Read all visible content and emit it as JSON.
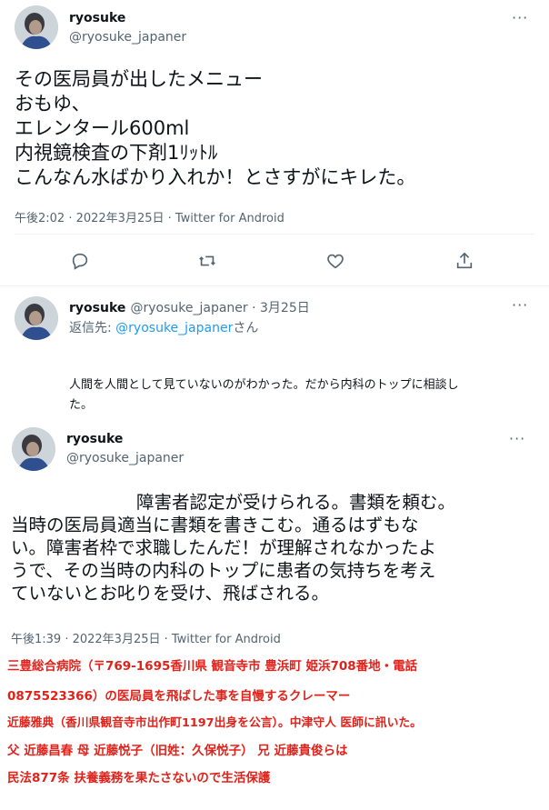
{
  "tweet1": {
    "name": "ryosuke",
    "handle": "@ryosuke_japaner",
    "more": "···",
    "body": "その医局員が出したメニュー\nおもゆ、\nエレンタール600ml\n内視鏡検査の下剤1ﾘｯﾄﾙ\nこんなん水ばかり入れか！とさすがにキレた。",
    "meta": "午後2:02 · 2022年3月25日 · Twitter for Android",
    "actions": [
      "reply-icon",
      "retweet-icon",
      "like-icon",
      "share-icon"
    ]
  },
  "tweet2": {
    "name": "ryosuke",
    "handle_date": "@ryosuke_japaner · 3月25日",
    "more": "···",
    "reply_prefix": "返信先: ",
    "reply_handle": "@ryosuke_japaner",
    "reply_suffix": "さん",
    "body_line1": "人間を人間として見ていないのがわかった。だから内科のトップに相談し",
    "body_line2": "た。"
  },
  "tweet3": {
    "name": "ryosuke",
    "handle": "@ryosuke_japaner",
    "more": "···",
    "line1": "障害者認定が受けられる。書類を頼む。",
    "line2": "当時の医局員適当に書類を書きこむ。通るはずもな",
    "line3": "い。障害者枠で求職したんだ！が理解されなかったよ",
    "line4": "うで、その当時の内科のトップに患者の気持ちを考え",
    "line5": "ていないとお叱りを受け、飛ばされる。",
    "meta": "午後1:39 · 2022年3月25日 · Twitter for Android"
  },
  "caption": {
    "line1": "三豊総合病院（〒769-1695香川県 観音寺市 豊浜町 姫浜708番地・電話",
    "line2": "0875523366）の医局員を飛ばした事を自慢するクレーマー",
    "line3": "近藤雅典（香川県観音寺市出作町1197出身を公言）。中津守人 医師に訊いた。",
    "line4": "父 近藤昌春 母 近藤悦子（旧姓：久保悦子） 兄 近藤貴俊らは",
    "line5": "民法877条 扶養義務を果たさないので生活保護",
    "color": "#e0221b"
  }
}
